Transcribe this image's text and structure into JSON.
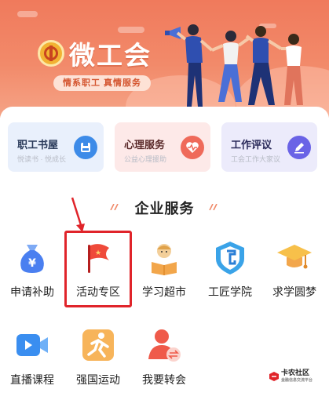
{
  "banner": {
    "app_name": "微工会",
    "slogan": "情系职工 真情服务"
  },
  "quick_cards": [
    {
      "title": "职工书屋",
      "subtitle": "悦读书 · 悦成长",
      "icon": "book-save-icon",
      "bg": "#e9f0fc",
      "title_color": "#2a3a5a",
      "icon_bg": "#3d8be8"
    },
    {
      "title": "心理服务",
      "subtitle": "公益心理援助",
      "icon": "heart-pulse-icon",
      "bg": "#fde9e8",
      "title_color": "#5a2a2a",
      "icon_bg": "#ef6a5a"
    },
    {
      "title": "工作评议",
      "subtitle": "工会工作大家议",
      "icon": "edit-pen-icon",
      "bg": "#ecebfb",
      "title_color": "#2a2a5a",
      "icon_bg": "#6a63e6"
    }
  ],
  "section": {
    "title": "企业服务"
  },
  "services": [
    {
      "label": "申请补助",
      "icon": "money-bag-icon"
    },
    {
      "label": "活动专区",
      "icon": "flag-icon"
    },
    {
      "label": "学习超市",
      "icon": "reading-person-icon"
    },
    {
      "label": "工匠学院",
      "icon": "academy-shield-icon"
    },
    {
      "label": "求学圆梦",
      "icon": "graduation-cap-icon"
    },
    {
      "label": "直播课程",
      "icon": "video-camera-icon"
    },
    {
      "label": "强国运动",
      "icon": "running-person-icon"
    },
    {
      "label": "我要转会",
      "icon": "user-transfer-icon"
    }
  ],
  "watermark": {
    "text": "卡农社区",
    "sub": "金融信息交流平台"
  },
  "colors": {
    "banner": "#f07a5c",
    "highlight": "#e0242a",
    "accent_red": "#ef4a3a"
  }
}
